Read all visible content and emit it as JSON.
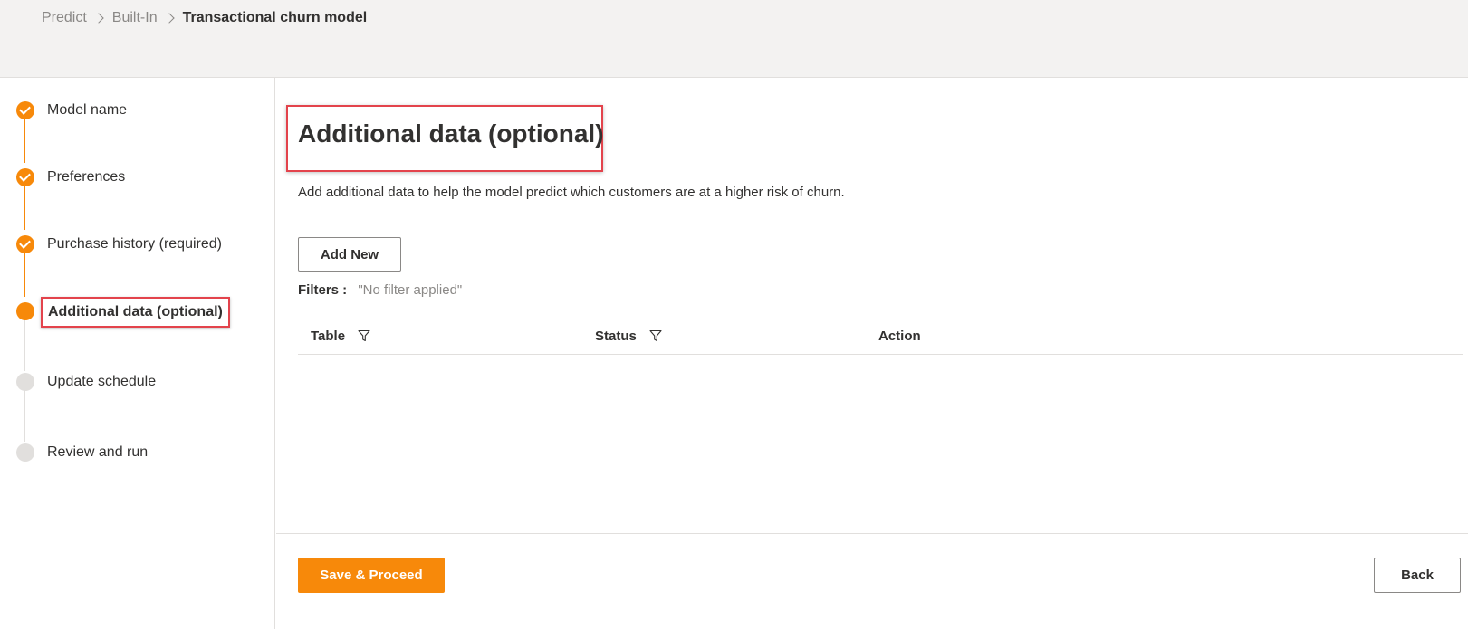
{
  "breadcrumb": {
    "items": [
      "Predict",
      "Built-In",
      "Transactional churn model"
    ]
  },
  "stepper": {
    "steps": [
      {
        "label": "Model name",
        "state": "done"
      },
      {
        "label": "Preferences",
        "state": "done"
      },
      {
        "label": "Purchase history (required)",
        "state": "done"
      },
      {
        "label": "Additional data (optional)",
        "state": "current"
      },
      {
        "label": "Update schedule",
        "state": "todo"
      },
      {
        "label": "Review and run",
        "state": "todo"
      }
    ]
  },
  "main": {
    "title": "Additional data (optional)",
    "description": "Add additional data to help the model predict which customers are at a higher risk of churn.",
    "add_new_label": "Add New",
    "filters_label": "Filters :",
    "filters_value": "\"No filter applied\"",
    "table": {
      "columns": [
        "Table",
        "Status",
        "Action"
      ],
      "rows": []
    }
  },
  "footer": {
    "save_label": "Save & Proceed",
    "back_label": "Back"
  },
  "colors": {
    "accent": "#f7890a",
    "highlight_border": "#e3434c",
    "inactive_step": "#e1dfdd",
    "header_bg": "#f3f2f1"
  },
  "icons": {
    "step_done": "checkmark-icon",
    "breadcrumb_separator": "chevron-right-icon",
    "column_filter": "filter-funnel-icon"
  }
}
